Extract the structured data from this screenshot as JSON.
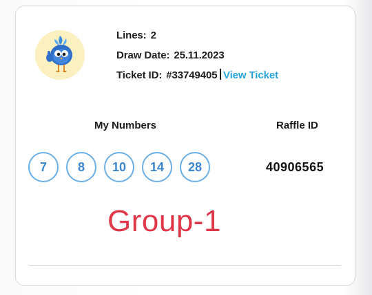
{
  "ticket": {
    "lines_label": "Lines:",
    "lines_value": "2",
    "draw_date_label": "Draw Date:",
    "draw_date_value": "25.11.2023",
    "ticket_id_label": "Ticket ID:",
    "ticket_id_value": "#33749405",
    "view_ticket_label": "View Ticket"
  },
  "columns": {
    "my_numbers": "My Numbers",
    "raffle_id": "Raffle ID"
  },
  "numbers": [
    "7",
    "8",
    "10",
    "14",
    "28"
  ],
  "raffle_id_value": "40906565",
  "group_label": "Group-1",
  "mascot_icon": "blue-bird-mascot-icon",
  "colors": {
    "accent_link": "#2aa3d8",
    "ball_border": "#6aaee6",
    "ball_text": "#3d86cf",
    "group_label": "#e0364a",
    "avatar_bg": "#fbf0c0"
  }
}
